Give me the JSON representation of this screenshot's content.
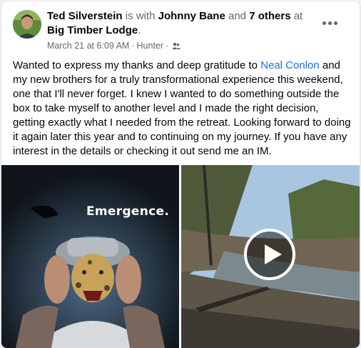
{
  "post": {
    "author": "Ted Silverstein",
    "is_with": "is with",
    "tagged_primary": "Johnny Bane",
    "and_word": "and",
    "tagged_others": "7 others",
    "at_word": "at",
    "location": "Big Timber Lodge",
    "period": ".",
    "timestamp": "March 21 at 6:09 AM",
    "separator": "·",
    "place": "Hunter",
    "separator2": "·",
    "audience_icon": "friends-icon",
    "more_icon": "more-options-icon",
    "text_before": "Wanted to express my thanks and deep gratitude to ",
    "mention": "Neal Conlon",
    "text_after": " and my new brothers for a truly transformational experience this weekend, one that I'll never forget. I knew I wanted to do something outside the box to take myself to another level and I made the right decision, getting exactly what I needed from the retreat.  Looking forward to doing it again later this year and to continuing on my journey. If you have any interest in the details or checking it out send me an IM."
  },
  "media": {
    "left_image_text": "Emergence.",
    "right_video_icon": "play-icon"
  },
  "colors": {
    "link": "#216fdb",
    "secondary_text": "#65676b",
    "primary_text": "#050505"
  }
}
